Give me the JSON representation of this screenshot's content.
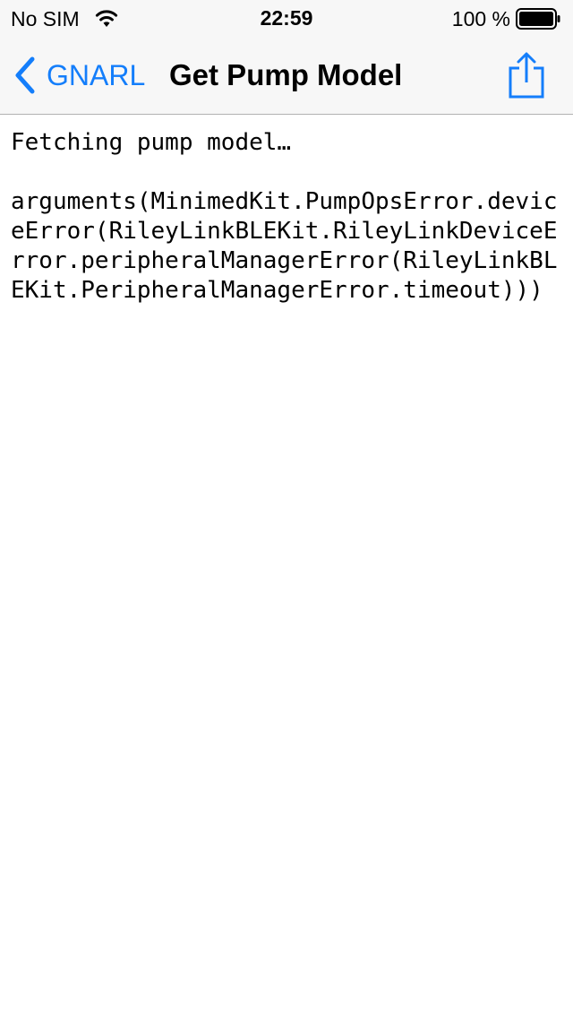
{
  "status_bar": {
    "carrier": "No SIM",
    "time": "22:59",
    "battery_percent": "100 %",
    "battery_level": 1.0,
    "icons": [
      "wifi-icon",
      "battery-icon"
    ]
  },
  "nav_bar": {
    "back_label": "GNARL",
    "title": "Get Pump Model",
    "icons": [
      "chevron-left-icon",
      "share-icon"
    ],
    "accent_color": "#147efb"
  },
  "content": {
    "status_message": "Fetching pump model…",
    "error_text": "arguments(MinimedKit.PumpOpsError.deviceError(RileyLinkBLEKit.RileyLinkDeviceError.peripheralManagerError(RileyLinkBLEKit.PeripheralManagerError.timeout)))"
  }
}
